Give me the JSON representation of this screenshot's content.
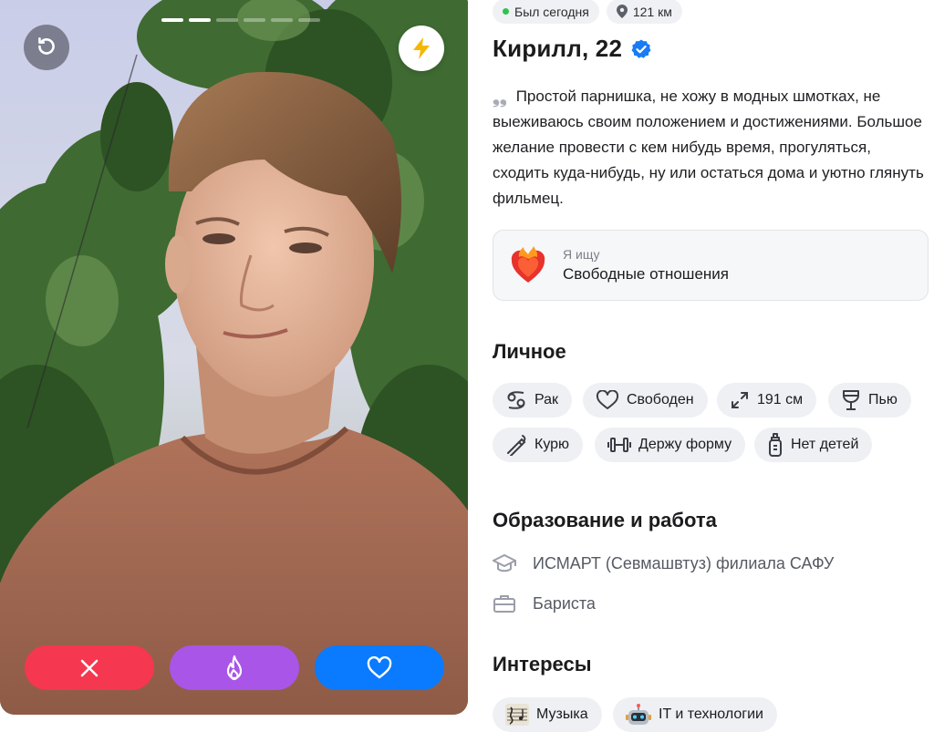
{
  "photo": {
    "progress_total": 6,
    "progress_active": 2
  },
  "icons": {
    "undo": "undo-icon",
    "boost": "lightning-icon",
    "dislike": "close-icon",
    "superlike": "flame-icon",
    "like": "heart-icon"
  },
  "colors": {
    "dislike": "#f5374f",
    "superlike": "#a855e8",
    "like": "#0a7bff",
    "boost": "#f5b800",
    "online": "#2fc24d",
    "verified": "#1a7cf5"
  },
  "status": {
    "last_seen": "Был сегодня",
    "distance": "121 км"
  },
  "profile": {
    "name_age": "Кирилл, 22",
    "bio": "Простой парнишка, не хожу в модных шмотках, не выеживаюсь своим положением и достижениями. Большое желание провести с кем нибудь время, прогуляться, сходить куда-нибудь, ну или остаться дома и уютно глянуть фильмец."
  },
  "seeking": {
    "label": "Я ищу",
    "value": "Свободные отношения"
  },
  "personal": {
    "title": "Личное",
    "chips": [
      {
        "icon": "cancer-zodiac-icon",
        "label": "Рак"
      },
      {
        "icon": "heart-outline-icon",
        "label": "Свободен"
      },
      {
        "icon": "expand-height-icon",
        "label": "191 см"
      },
      {
        "icon": "wine-glass-icon",
        "label": "Пью"
      },
      {
        "icon": "cigarette-icon",
        "label": "Курю"
      },
      {
        "icon": "dumbbell-icon",
        "label": "Держу форму"
      },
      {
        "icon": "baby-bottle-icon",
        "label": "Нет детей"
      }
    ]
  },
  "education": {
    "title": "Образование и работа",
    "school": "ИСМАРТ (Севмашвтуз) филиала САФУ",
    "job": "Бариста"
  },
  "interests": {
    "title": "Интересы",
    "chips": [
      {
        "icon": "music-sheet-icon",
        "label": "Музыка"
      },
      {
        "icon": "robot-icon",
        "label": "IT и технологии"
      }
    ]
  }
}
